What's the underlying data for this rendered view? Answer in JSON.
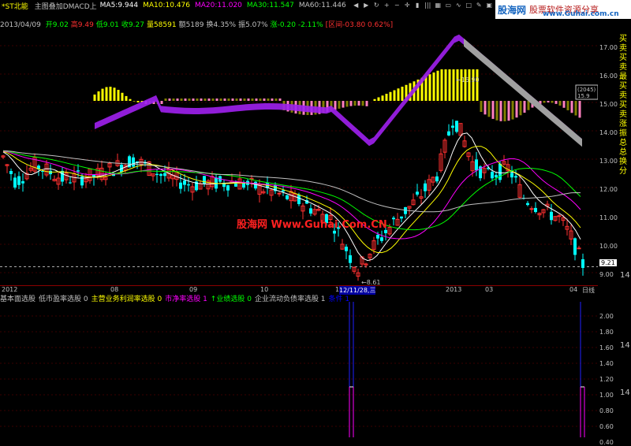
{
  "toolbar": {
    "buttons": [
      "back-icon",
      "forward-icon",
      "refresh-icon",
      "zoom-in-icon",
      "zoom-out-icon",
      "crosshair-icon",
      "kline-icon",
      "bars-icon",
      "grid-icon",
      "window-icon",
      "indicator-icon",
      "rect-icon",
      "draw-icon",
      "camera-icon",
      "settings-icon",
      "tools-icon",
      "save-icon"
    ],
    "stock_name": "*ST北能",
    "indicator": "主图叠加DMACD上",
    "ma": [
      {
        "label": "MA5:",
        "value": "9.944",
        "color": "#ffffff"
      },
      {
        "label": "MA10:",
        "value": "10.476",
        "color": "#ffff00"
      },
      {
        "label": "MA20:",
        "value": "11.020",
        "color": "#ff00ff"
      },
      {
        "label": "MA30:",
        "value": "11.547",
        "color": "#00ff00"
      },
      {
        "label": "MA60:",
        "value": "11.446",
        "color": "#c0c0c0"
      }
    ]
  },
  "info_row": {
    "date": "2013/04/09",
    "items": [
      {
        "text": "开9.02",
        "color": "#00ff00"
      },
      {
        "text": "高9.49",
        "color": "#ff3030"
      },
      {
        "text": "低9.01",
        "color": "#00ff00"
      },
      {
        "text": "收9.27",
        "color": "#00ff00"
      },
      {
        "text": "量58591",
        "color": "#ffff00"
      },
      {
        "text": "额5189",
        "color": "#c0c0c0"
      },
      {
        "text": "换4.35%",
        "color": "#c0c0c0"
      },
      {
        "text": "振5.07%",
        "color": "#c0c0c0"
      },
      {
        "text": "涨-0.20 -2.11%",
        "color": "#00ff00"
      },
      {
        "text": "[区间-03.80 0.62%]",
        "color": "#ff3030"
      }
    ]
  },
  "site_logo": {
    "name": "股海网",
    "slogan": "股票软件资源分享",
    "url": "www.Guhai.com.cn"
  },
  "price_axis": {
    "labels": [
      "17.00",
      "16.00",
      "15.00",
      "14.00",
      "13.00",
      "12.00",
      "11.00",
      "10.00",
      "9.00"
    ],
    "current_price": "9.21",
    "right_edge": "14"
  },
  "price_annotations": {
    "high": "15.90",
    "low": "8.61",
    "box": "(2045)",
    "box_value": "15.9"
  },
  "side_tabs": [
    "买",
    "卖",
    "买",
    "卖",
    "最",
    "买",
    "卖",
    "买",
    "卖",
    "涨",
    "振",
    "总",
    "总",
    "换",
    "分"
  ],
  "date_axis": {
    "labels": [
      "2012",
      "08",
      "09",
      "10",
      "11",
      "12/11/28,三",
      "2013",
      "03",
      "04",
      "日线"
    ]
  },
  "sub_header": {
    "items": [
      {
        "text": "基本面选股",
        "color": "#c0c0c0"
      },
      {
        "text": "低市盈率选股 0",
        "color": "#c0c0c0"
      },
      {
        "text": "主营业务利润率选股 0",
        "color": "#ffff00"
      },
      {
        "text": "市净率选股 1",
        "color": "#ff00ff"
      },
      {
        "text": "↑业绩选股 0",
        "color": "#00ff00"
      },
      {
        "text": "企业流动负债率选股 1",
        "color": "#c0c0c0"
      },
      {
        "text": "条件 1",
        "color": "#0000ff"
      }
    ]
  },
  "sub_axis": {
    "labels": [
      "2.00",
      "1.80",
      "1.60",
      "1.40",
      "1.20",
      "1.00",
      "0.80",
      "0.60",
      "0.40"
    ],
    "right_edge": [
      "14",
      "14"
    ]
  },
  "watermark": "股海网 Www.Guhai.Com.CN"
}
